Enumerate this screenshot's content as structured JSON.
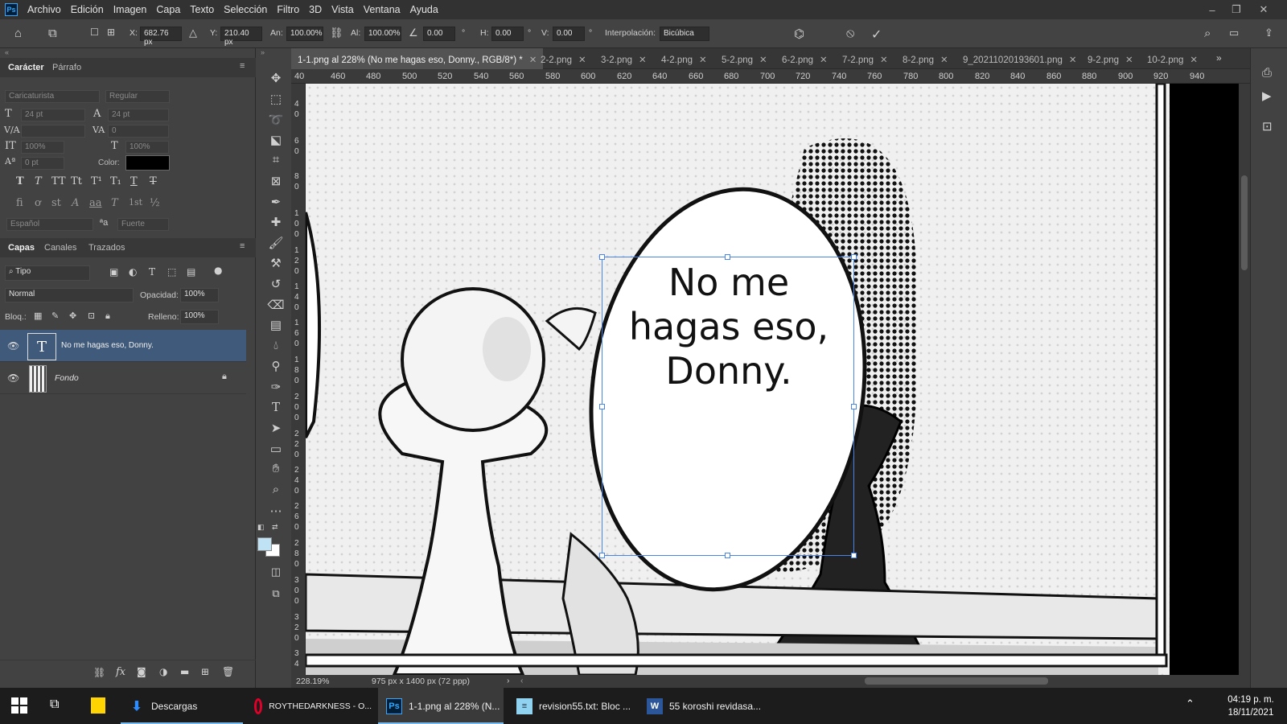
{
  "app": {
    "logo": "Ps",
    "menu": [
      "Archivo",
      "Edición",
      "Imagen",
      "Capa",
      "Texto",
      "Selección",
      "Filtro",
      "3D",
      "Vista",
      "Ventana",
      "Ayuda"
    ]
  },
  "options": {
    "x_label": "X:",
    "x_value": "682.76 px",
    "y_label": "Y:",
    "y_value": "210.40 px",
    "w_label": "An:",
    "w_value": "100.00%",
    "h_label": "Al:",
    "h_value": "100.00%",
    "angle_value": "0.00",
    "angle_unit": "°",
    "hskew_label": "H:",
    "hskew_value": "0.00",
    "hskew_unit": "°",
    "vskew_label": "V:",
    "vskew_value": "0.00",
    "vskew_unit": "°",
    "interp_label": "Interpolación:",
    "interp_value": "Bicúbica"
  },
  "character_panel": {
    "tab_character": "Carácter",
    "tab_paragraph": "Párrafo",
    "font_family": "Caricaturista",
    "font_style": "Regular",
    "font_size": "24 pt",
    "leading": "24 pt",
    "tracking": "0",
    "vscale": "100%",
    "hscale": "100%",
    "baseline": "0 pt",
    "color_label": "Color:",
    "language": "Español",
    "antialias": "Fuerte",
    "aa_icon": "ªa",
    "style_glyphs": [
      "T",
      "T",
      "TT",
      "Tt",
      "T¹",
      "T₁",
      "T",
      "T"
    ],
    "opentype_glyphs": [
      "fi",
      "ơ",
      "st",
      "A",
      "aa",
      "T",
      "1st",
      "½"
    ]
  },
  "layers_panel": {
    "tab_layers": "Capas",
    "tab_channels": "Canales",
    "tab_paths": "Trazados",
    "filter": "Tipo",
    "blend_mode": "Normal",
    "opacity_label": "Opacidad:",
    "opacity_value": "100%",
    "lock_label": "Bloq.:",
    "fill_label": "Relleno:",
    "fill_value": "100%",
    "layers": [
      {
        "name": "No me hagas eso, Donny.",
        "type_glyph": "T"
      },
      {
        "name": "Fondo"
      }
    ]
  },
  "doc_tabs": [
    {
      "label": "1-1.png al 228% (No me hagas eso, Donny., RGB/8*) *"
    },
    {
      "label": "2-2.png"
    },
    {
      "label": "3-2.png"
    },
    {
      "label": "4-2.png"
    },
    {
      "label": "5-2.png"
    },
    {
      "label": "6-2.png"
    },
    {
      "label": "7-2.png"
    },
    {
      "label": "8-2.png"
    },
    {
      "label": "9_20211020193601.png"
    },
    {
      "label": "9-2.png"
    },
    {
      "label": "10-2.png"
    }
  ],
  "ruler": {
    "h_ticks": [
      "40",
      "460",
      "480",
      "500",
      "520",
      "540",
      "560",
      "580",
      "600",
      "620",
      "640",
      "660",
      "680",
      "700",
      "720",
      "740",
      "760",
      "780",
      "800",
      "820",
      "840",
      "860",
      "880",
      "900",
      "920",
      "940"
    ],
    "v_ticks": [
      "4",
      "0",
      "6",
      "0",
      "8",
      "0",
      "1",
      "0",
      "0",
      "1",
      "2",
      "0",
      "1",
      "4",
      "0",
      "1",
      "6",
      "0",
      "1",
      "8",
      "0",
      "2",
      "0",
      "0",
      "2",
      "2",
      "0",
      "2",
      "4",
      "0",
      "2",
      "6",
      "0",
      "2",
      "8",
      "0",
      "3",
      "0",
      "0",
      "3",
      "2",
      "0",
      "3",
      "4"
    ]
  },
  "canvas": {
    "speech_text_lines": [
      "No me",
      "hagas eso,",
      "Donny."
    ]
  },
  "status": {
    "zoom": "228.19%",
    "doc_size": "975 px x 1400 px (72 ppp)"
  },
  "taskbar": {
    "items": [
      {
        "label": "Descargas"
      },
      {
        "label": "ROYTHEDARKNESS - O..."
      },
      {
        "label": "1-1.png al 228% (N...",
        "icon_text": "Ps"
      },
      {
        "label": "revision55.txt: Bloc ..."
      },
      {
        "label": "55 koroshi revidasa...",
        "icon_text": "W"
      }
    ],
    "time": "04:19 p. m.",
    "date": "18/11/2021"
  },
  "colors": {
    "accent": "#31a8ff",
    "selected_layer": "#3f5a7a",
    "foreground_swatch": "#bfe3f5"
  }
}
